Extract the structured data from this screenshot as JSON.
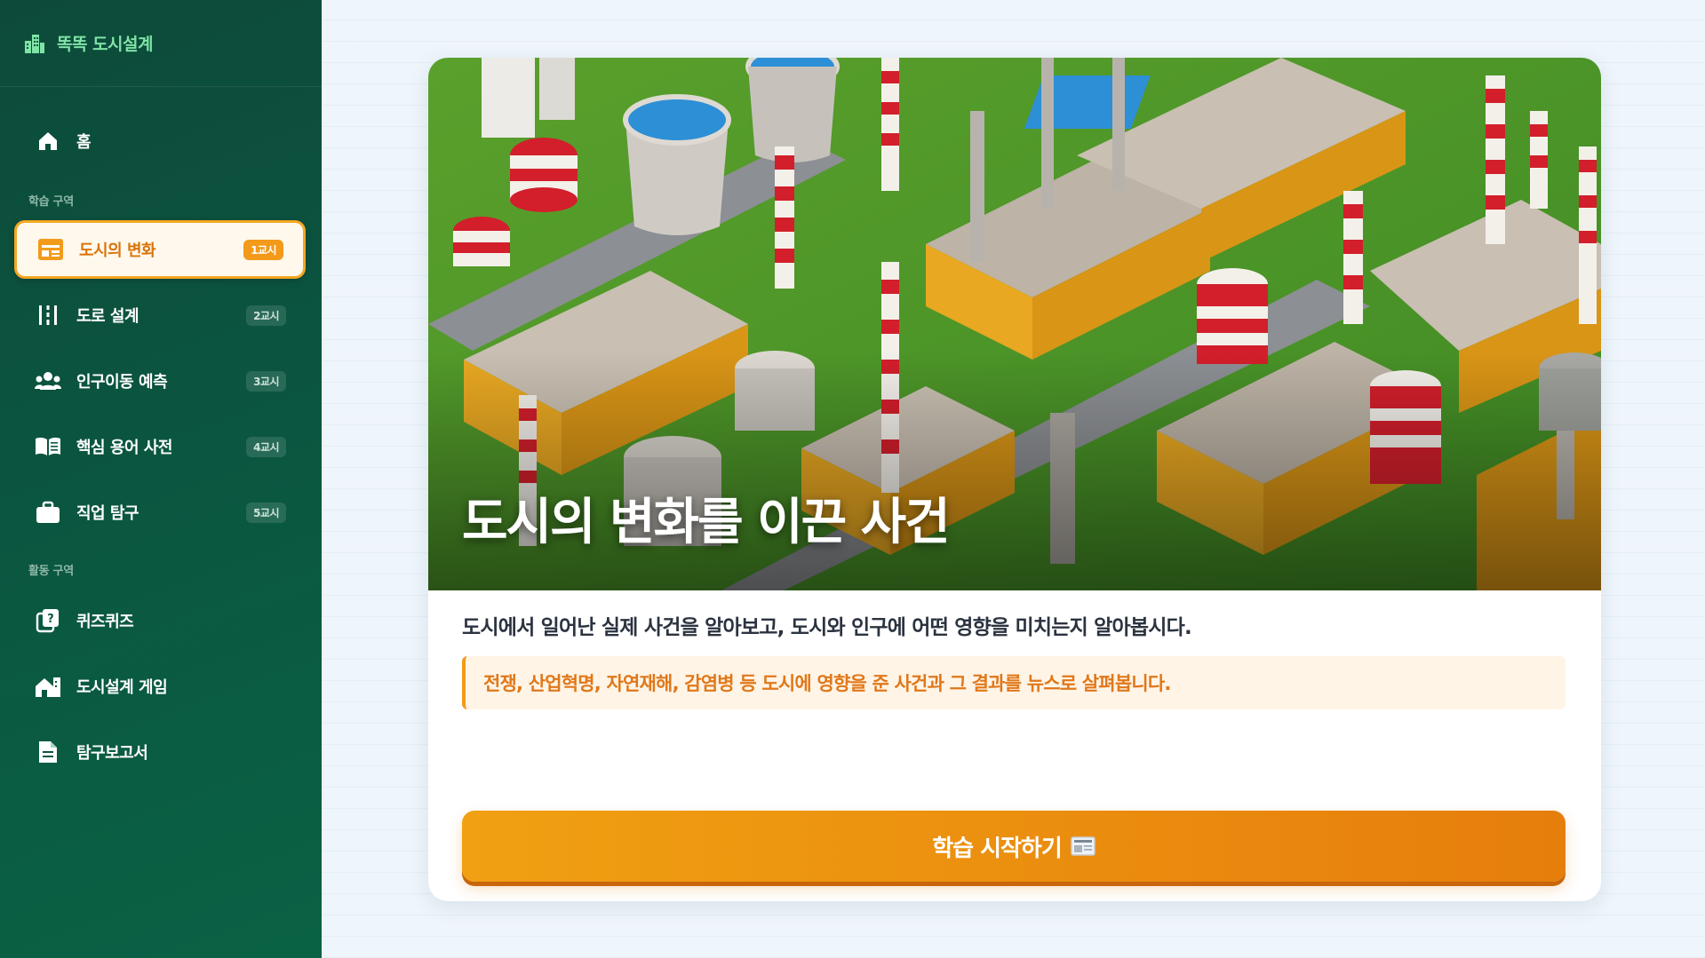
{
  "brand": {
    "title": "똑똑 도시설계",
    "icon": "city-buildings-icon"
  },
  "sidebar": {
    "home": {
      "label": "홈",
      "icon": "home-icon"
    },
    "section_learning": "학습 구역",
    "section_activity": "활동 구역",
    "items": [
      {
        "label": "도시의 변화",
        "badge": "1교시",
        "icon": "calendar-icon",
        "active": true
      },
      {
        "label": "도로 설계",
        "badge": "2교시",
        "icon": "road-icon",
        "active": false
      },
      {
        "label": "인구이동 예측",
        "badge": "3교시",
        "icon": "people-icon",
        "active": false
      },
      {
        "label": "핵심 용어 사전",
        "badge": "4교시",
        "icon": "book-icon",
        "active": false
      },
      {
        "label": "직업 탐구",
        "badge": "5교시",
        "icon": "briefcase-icon",
        "active": false
      },
      {
        "label": "퀴즈퀴즈",
        "icon": "quiz-icon"
      },
      {
        "label": "도시설계 게임",
        "icon": "city-game-icon"
      },
      {
        "label": "탐구보고서",
        "icon": "report-icon"
      }
    ]
  },
  "main": {
    "hero_title": "도시의 변화를 이끈 사건",
    "description": "도시에서 일어난 실제 사건을 알아보고, 도시와 인구에 어떤 영향을 미치는지 알아봅시다.",
    "note": "전쟁, 산업혁명, 자연재해, 감염병 등 도시에 영향을 준 사건과 그 결과를 뉴스로 살펴봅니다.",
    "start_button": "학습 시작하기",
    "start_icon": "newspaper-icon"
  },
  "colors": {
    "sidebar": "#0b5540",
    "accent": "#f39a1a",
    "brand": "#7fe3a6",
    "active_text": "#d9740a"
  }
}
